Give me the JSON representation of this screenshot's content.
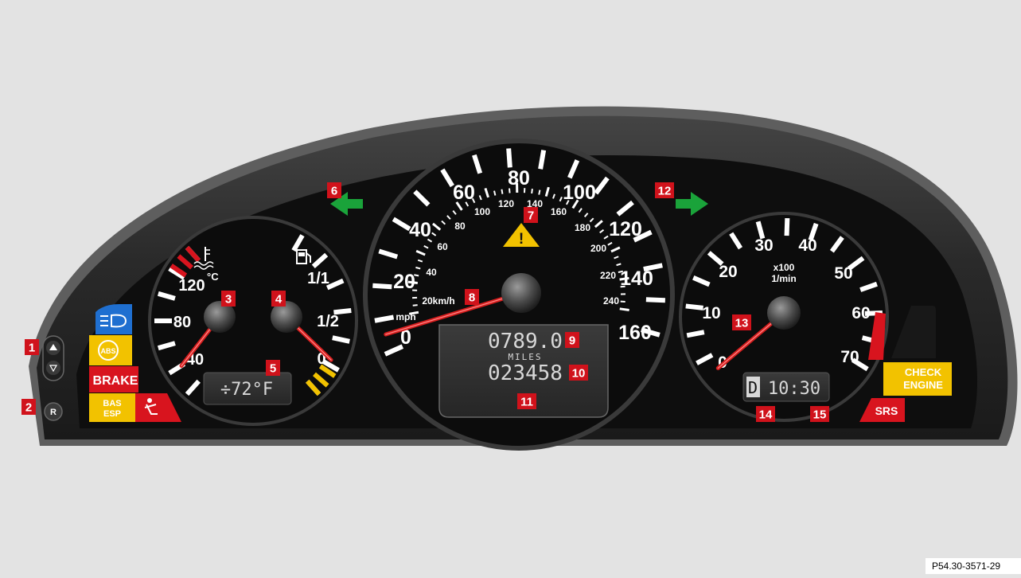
{
  "figure_code": "P54.30-3571-29",
  "colors": {
    "background": "#e3e3e3",
    "housing": "#2b2b2b",
    "dial_face": "#0c0c0c",
    "needle": "#d81f1f",
    "callout": "#d0121b",
    "turn_signal": "#1aa33a",
    "warning_yellow": "#f2c200",
    "lamp_red": "#d8141e",
    "lamp_blue": "#1f6fd0"
  },
  "callouts": [
    {
      "id": "1",
      "label": "1"
    },
    {
      "id": "2",
      "label": "2"
    },
    {
      "id": "3",
      "label": "3"
    },
    {
      "id": "4",
      "label": "4"
    },
    {
      "id": "5",
      "label": "5"
    },
    {
      "id": "6",
      "label": "6"
    },
    {
      "id": "7",
      "label": "7"
    },
    {
      "id": "8",
      "label": "8"
    },
    {
      "id": "9",
      "label": "9"
    },
    {
      "id": "10",
      "label": "10"
    },
    {
      "id": "11",
      "label": "11"
    },
    {
      "id": "12",
      "label": "12"
    },
    {
      "id": "13",
      "label": "13"
    },
    {
      "id": "14",
      "label": "14"
    },
    {
      "id": "15",
      "label": "15"
    }
  ],
  "left_gauge": {
    "coolant_labels": [
      "120",
      "80",
      "40"
    ],
    "coolant_unit": "°C",
    "fuel_labels": [
      "1/1",
      "1/2",
      "0"
    ],
    "outside_temp_display": "÷72°F"
  },
  "speedometer": {
    "mph_labels": [
      "0",
      "20",
      "40",
      "60",
      "80",
      "100",
      "120",
      "140",
      "160"
    ],
    "kmh_labels": [
      "20km/h",
      "40",
      "60",
      "80",
      "100",
      "120",
      "140",
      "160",
      "180",
      "200",
      "220",
      "240"
    ],
    "unit_mph": "mph",
    "trip_display": "0789.0",
    "odometer_unit": "MILES",
    "odometer_display": "023458"
  },
  "tachometer": {
    "labels": [
      "0",
      "10",
      "20",
      "30",
      "40",
      "50",
      "60",
      "70"
    ],
    "scale_note_1": "x100",
    "scale_note_2": "1/min",
    "gear_display": "D",
    "clock_display": "10:30"
  },
  "warning_lamps": {
    "brake": "BRAKE",
    "abs": "ABS",
    "bas_esp_1": "BAS",
    "bas_esp_2": "ESP",
    "check_engine_1": "CHECK",
    "check_engine_2": "ENGINE",
    "srs": "SRS",
    "reset_button": "R",
    "caution": "!"
  }
}
